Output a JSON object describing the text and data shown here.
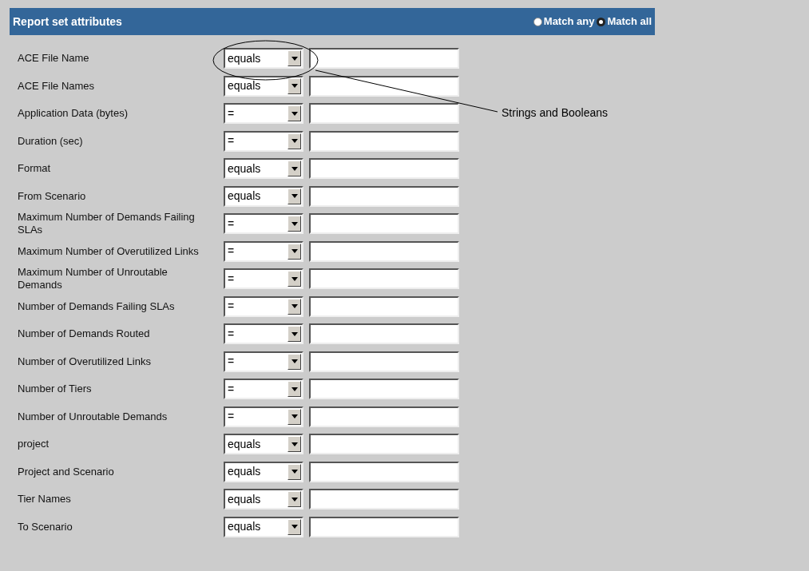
{
  "header": {
    "title": "Report set attributes",
    "match_options": [
      {
        "label": "Match any",
        "selected": false
      },
      {
        "label": "Match all",
        "selected": true
      }
    ]
  },
  "rows": [
    {
      "label": "ACE File Name",
      "operator": "equals"
    },
    {
      "label": "ACE File Names",
      "operator": "equals"
    },
    {
      "label": "Application Data (bytes)",
      "operator": "="
    },
    {
      "label": "Duration (sec)",
      "operator": "="
    },
    {
      "label": "Format",
      "operator": "equals"
    },
    {
      "label": "From Scenario",
      "operator": "equals"
    },
    {
      "label": "Maximum Number of Demands Failing SLAs",
      "operator": "="
    },
    {
      "label": "Maximum Number of Overutilized Links",
      "operator": "="
    },
    {
      "label": "Maximum Number of Unroutable Demands",
      "operator": "="
    },
    {
      "label": "Number of Demands Failing SLAs",
      "operator": "="
    },
    {
      "label": "Number of Demands Routed",
      "operator": "="
    },
    {
      "label": "Number of Overutilized Links",
      "operator": "="
    },
    {
      "label": "Number of Tiers",
      "operator": "="
    },
    {
      "label": "Number of Unroutable Demands",
      "operator": "="
    },
    {
      "label": "project",
      "operator": "equals"
    },
    {
      "label": "Project and Scenario",
      "operator": "equals"
    },
    {
      "label": "Tier Names",
      "operator": "equals"
    },
    {
      "label": "To Scenario",
      "operator": "equals"
    }
  ],
  "annotation": {
    "text": "Strings and Booleans"
  }
}
